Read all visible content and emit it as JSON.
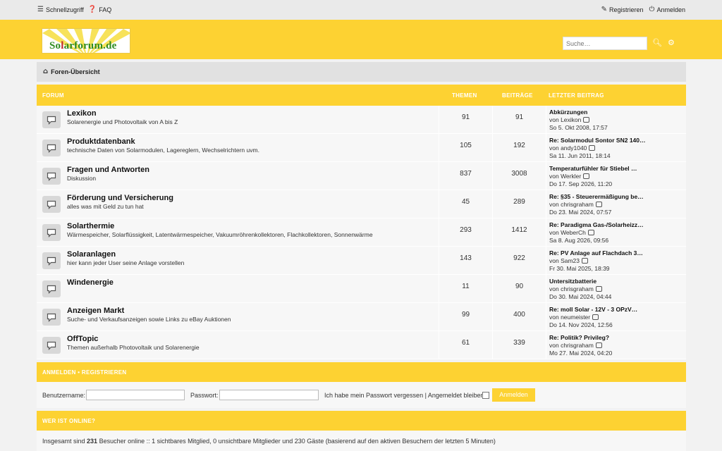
{
  "topbar": {
    "quick_access": "Schnellzugriff",
    "faq": "FAQ",
    "register": "Registrieren",
    "login": "Anmelden"
  },
  "header": {
    "logo_text_pre": "So",
    "logo_text_mark": "l",
    "logo_text_post": "arforum.de",
    "search_placeholder": "Suche…"
  },
  "breadcrumb": {
    "home": "Foren-Übersicht"
  },
  "forum_table": {
    "col_forum": "FORUM",
    "col_topics": "THEMEN",
    "col_posts": "BEITRÄGE",
    "col_last": "LETZTER BEITRAG",
    "rows": [
      {
        "title": "Lexikon",
        "desc": "Solarenergie und Photovoltaik von A bis Z",
        "topics": "91",
        "posts": "91",
        "last_title": "Abkürzungen",
        "last_by": "von Lexikon",
        "last_date": "So 5. Okt 2008, 17:57"
      },
      {
        "title": "Produktdatenbank",
        "desc": "technische Daten von Solarmodulen, Lagereglern, Wechselrichtern uvm.",
        "topics": "105",
        "posts": "192",
        "last_title": "Re: Solarmodul Sontor SN2 140…",
        "last_by": "von andy1040",
        "last_date": "Sa 11. Jun 2011, 18:14"
      },
      {
        "title": "Fragen und Antworten",
        "desc": "Diskussion",
        "topics": "837",
        "posts": "3008",
        "last_title": "Temperaturfühler für Stiebel …",
        "last_by": "von Werkler",
        "last_date": "Do 17. Sep 2026, 11:20"
      },
      {
        "title": "Förderung und Versicherung",
        "desc": "alles was mit Geld zu tun hat",
        "topics": "45",
        "posts": "289",
        "last_title": "Re: §35 - Steuerermäßigung be…",
        "last_by": "von chrisgraham",
        "last_date": "Do 23. Mai 2024, 07:57"
      },
      {
        "title": "Solarthermie",
        "desc": "Wärmespeicher, Solarflüssigkeit, Latentwärmespeicher, Vakuumröhrenkollektoren, Flachkollektoren, Sonnenwärme",
        "topics": "293",
        "posts": "1412",
        "last_title": "Re: Paradigma Gas-/Solarheizz…",
        "last_by": "von WeberCh",
        "last_date": "Sa 8. Aug 2026, 09:56"
      },
      {
        "title": "Solaranlagen",
        "desc": "hier kann jeder User seine Anlage vorstellen",
        "topics": "143",
        "posts": "922",
        "last_title": "Re: PV Anlage auf Flachdach 3…",
        "last_by": "von Sam23",
        "last_date": "Fr 30. Mai 2025, 18:39"
      },
      {
        "title": "Windenergie",
        "desc": "",
        "topics": "11",
        "posts": "90",
        "last_title": "Untersitzbatterie",
        "last_by": "von chrisgraham",
        "last_date": "Do 30. Mai 2024, 04:44"
      },
      {
        "title": "Anzeigen Markt",
        "desc": "Suche- und Verkaufsanzeigen sowie Links zu eBay Auktionen",
        "topics": "99",
        "posts": "400",
        "last_title": "Re: moll Solar - 12V - 3 OPzV…",
        "last_by": "von neumeister",
        "last_date": "Do 14. Nov 2024, 12:56"
      },
      {
        "title": "OffTopic",
        "desc": "Themen außerhalb Photovoltaik und Solarenergie",
        "topics": "61",
        "posts": "339",
        "last_title": "Re: Politik? Privileg?",
        "last_by": "von chrisgraham",
        "last_date": "Mo 27. Mai 2024, 04:20"
      }
    ]
  },
  "login_panel": {
    "heading": "ANMELDEN  •  REGISTRIEREN",
    "username_label": "Benutzername:",
    "password_label": "Passwort:",
    "links": "Ich habe mein Passwort vergessen | Angemeldet bleiben",
    "button": "Anmelden"
  },
  "online": {
    "heading": "WER IST ONLINE?",
    "text_pre": "Insgesamt sind",
    "count": "231",
    "text_post": "Besucher online :: 1 sichtbares Mitglied, 0 unsichtbare Mitglieder und 230 Gäste (basierend auf den aktiven Besuchern der letzten 5 Minuten)"
  },
  "colors": {
    "accent": "#fdd232",
    "topbar": "#eaeaea",
    "row": "#f7f7f7"
  }
}
